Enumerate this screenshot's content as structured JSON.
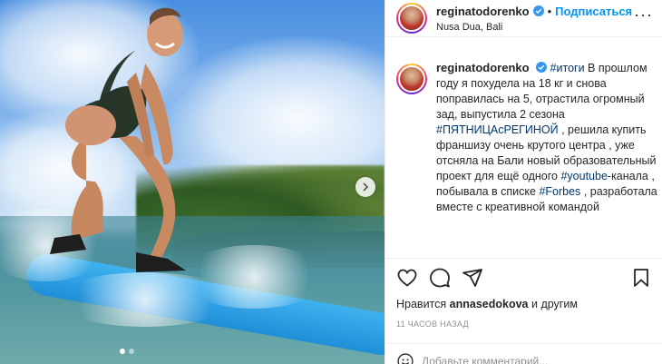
{
  "post": {
    "username": "reginatodorenko",
    "location": "Nusa Dua, Bali",
    "follow_label": "Подписаться",
    "separator": "•",
    "more_label": "···",
    "caption": {
      "username": "reginatodorenko",
      "hashtag_top": "#итоги",
      "text1": "В прошлом году я похудела на 18 кг и снова поправилась на 5, отрастила огромный зад, выпустила 2 сезона",
      "hashtag_show": "#ПЯТНИЦАсРЕГИНОЙ",
      "text2": ", решила купить франшизу очень крутого центра , уже отсняла на Бали новый образовательный проект для ещё одного",
      "hashtag_youtube": "#youtube",
      "text3": "-канала , побывала в списке",
      "hashtag_forbes": "#Forbes",
      "text4": ", разработала вместе с креативной командой"
    },
    "likes": {
      "prefix": "Нравится",
      "liker": "annasedokova",
      "suffix": "и другим"
    },
    "timestamp": "11 часов назад",
    "comment_placeholder": "Добавьте комментарий..."
  },
  "carousel": {
    "slide_count": 2,
    "active_index": 0
  },
  "icons": {
    "like": "heart-icon",
    "comment": "comment-icon",
    "share": "paper-plane-icon",
    "save": "bookmark-icon",
    "verified": "verified-badge-icon",
    "next": "chevron-right-icon",
    "emoji": "smiley-icon"
  },
  "colors": {
    "accent": "#0095f6",
    "verified": "#3897f0",
    "hashtag": "#00376b",
    "text": "#262626",
    "muted": "#8e8e8e"
  }
}
